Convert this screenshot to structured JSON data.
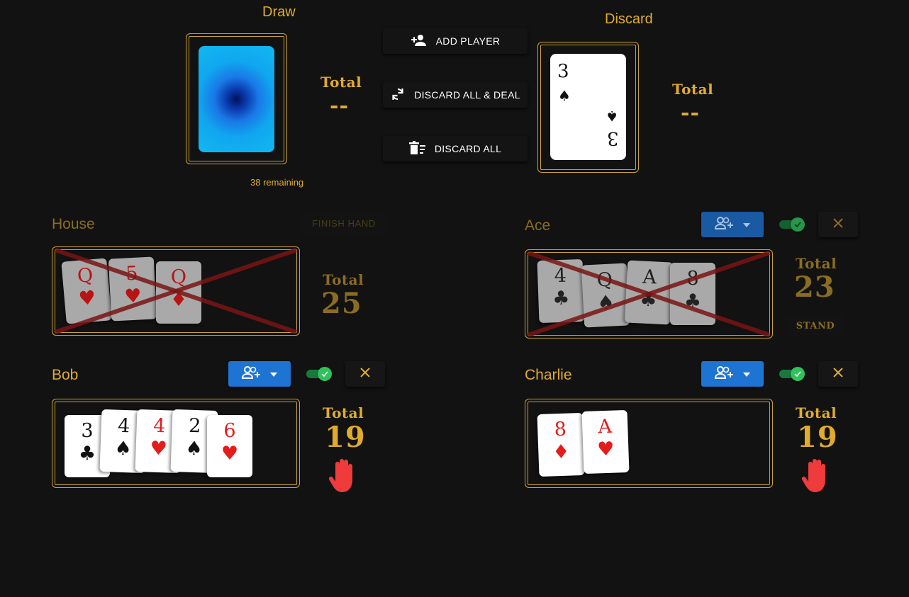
{
  "draw": {
    "title": "Draw",
    "remaining": "38 remaining",
    "total_label": "Total",
    "total_value": "--"
  },
  "discard": {
    "title": "Discard",
    "total_label": "Total",
    "total_value": "--",
    "top_card": {
      "rank": "3",
      "suit": "♠"
    }
  },
  "actions": {
    "add_player": "ADD PLAYER",
    "discard_all_deal": "DISCARD ALL & DEAL",
    "discard_all": "DISCARD ALL"
  },
  "players": {
    "house": {
      "name": "House",
      "action_label": "FINISH HAND",
      "total_label": "Total",
      "total_value": "25",
      "busted": true,
      "cards": [
        {
          "rank": "Q",
          "suit": "♥",
          "color": "red"
        },
        {
          "rank": "5",
          "suit": "♥",
          "color": "red"
        },
        {
          "rank": "Q",
          "suit": "♦",
          "color": "red"
        }
      ]
    },
    "ace": {
      "name": "Ace",
      "status_label": "STAND",
      "total_label": "Total",
      "total_value": "23",
      "busted": true,
      "cards": [
        {
          "rank": "4",
          "suit": "♣",
          "color": "black"
        },
        {
          "rank": "Q",
          "suit": "♠",
          "color": "black"
        },
        {
          "rank": "A",
          "suit": "♣",
          "color": "black"
        },
        {
          "rank": "8",
          "suit": "♣",
          "color": "black"
        }
      ]
    },
    "bob": {
      "name": "Bob",
      "total_label": "Total",
      "total_value": "19",
      "busted": false,
      "cards": [
        {
          "rank": "3",
          "suit": "♣",
          "color": "black"
        },
        {
          "rank": "4",
          "suit": "♠",
          "color": "black"
        },
        {
          "rank": "4",
          "suit": "♥",
          "color": "red"
        },
        {
          "rank": "2",
          "suit": "♠",
          "color": "black"
        },
        {
          "rank": "6",
          "suit": "♥",
          "color": "red"
        }
      ]
    },
    "charlie": {
      "name": "Charlie",
      "total_label": "Total",
      "total_value": "19",
      "busted": false,
      "cards": [
        {
          "rank": "8",
          "suit": "♦",
          "color": "red"
        },
        {
          "rank": "A",
          "suit": "♥",
          "color": "red"
        }
      ]
    }
  },
  "icons": {
    "add_player": "person-add-icon",
    "deal": "refresh-icon",
    "discard": "delete-sweep-icon",
    "player_menu": "group-add-icon",
    "dropdown": "caret-down-icon",
    "active": "toggle-check-icon",
    "remove": "close-icon",
    "stop": "raised-hand-icon"
  },
  "colors": {
    "gold": "#e0ac2c",
    "blue": "#1e74d3",
    "green": "#2fc25a",
    "stop": "#ef3b3b",
    "bust_cross": "#7a1515"
  }
}
